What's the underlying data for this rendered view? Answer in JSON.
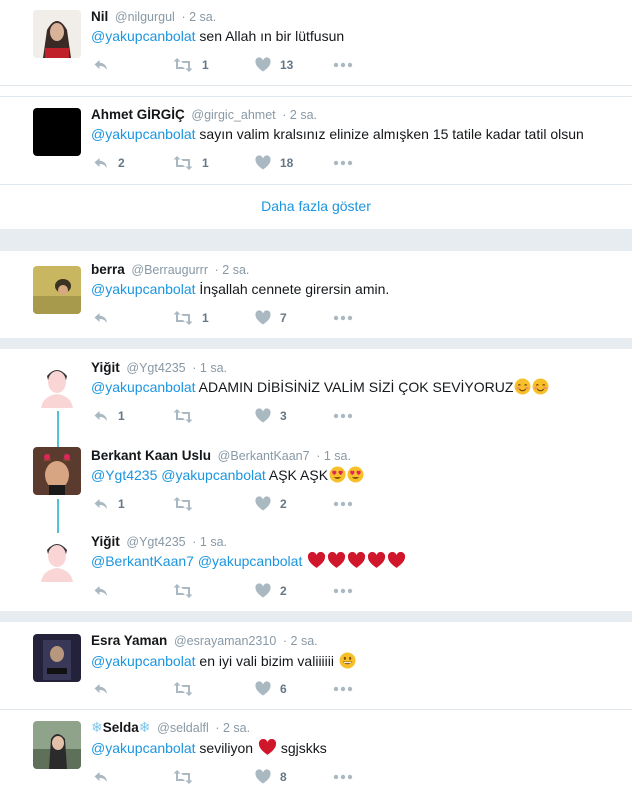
{
  "tweets": [
    {
      "name": "Nil",
      "handle": "@nilgurgul",
      "time": "· 2 sa.",
      "mention": "@yakupcanbolat",
      "text": " sen Allah ın bir lütfusun",
      "reply": "",
      "retweet": "1",
      "like": "13"
    },
    {
      "name": "Ahmet GİRGİÇ",
      "handle": "@girgic_ahmet",
      "time": "· 2 sa.",
      "mention": "@yakupcanbolat",
      "text": " sayın valim kralsınız elinize almışken 15 tatile kadar tatil olsun",
      "reply": "2",
      "retweet": "1",
      "like": "18"
    },
    {
      "name": "berra",
      "handle": "@Berraugurrr",
      "time": "· 2 sa.",
      "mention": "@yakupcanbolat",
      "text": " İnşallah cennete girersin amin.",
      "reply": "",
      "retweet": "1",
      "like": "7"
    },
    {
      "name": "Yiğit",
      "handle": "@Ygt4235",
      "time": "· 1 sa.",
      "mention": "@yakupcanbolat",
      "text": " ADAMIN DİBİSİNİZ VALİM SİZİ ÇOK SEVİYORUZ",
      "reply": "1",
      "retweet": "",
      "like": "3"
    },
    {
      "name": "Berkant Kaan Uslu",
      "handle": "@BerkantKaan7",
      "time": "· 1 sa.",
      "mention": "@Ygt4235 @yakupcanbolat",
      "text": " AŞK AŞK",
      "reply": "1",
      "retweet": "",
      "like": "2"
    },
    {
      "name": "Yiğit",
      "handle": "@Ygt4235",
      "time": "· 1 sa.",
      "mention": "@BerkantKaan7 @yakupcanbolat",
      "text": " ",
      "reply": "",
      "retweet": "",
      "like": "2"
    },
    {
      "name": "Esra Yaman",
      "handle": "@esrayaman2310",
      "time": "· 2 sa.",
      "mention": "@yakupcanbolat",
      "text": " en iyi vali bizim valiiiiii ",
      "reply": "",
      "retweet": "",
      "like": "6"
    },
    {
      "name": "Selda",
      "handle": "@seldalfl",
      "time": "· 2 sa.",
      "mention": "@yakupcanbolat",
      "text": " seviliyon ",
      "text2": " sgjskks",
      "reply": "",
      "retweet": "",
      "like": "8"
    }
  ],
  "show_more": "Daha fazla göster",
  "icons": {
    "reply": "reply-icon",
    "retweet": "retweet-icon",
    "like": "heart-icon",
    "more": "more-dots-icon"
  },
  "colors": {
    "mention": "#1b95e0",
    "icon": "#aab8c2",
    "heart": "#e0245e",
    "thread": "#4fc3d8"
  }
}
